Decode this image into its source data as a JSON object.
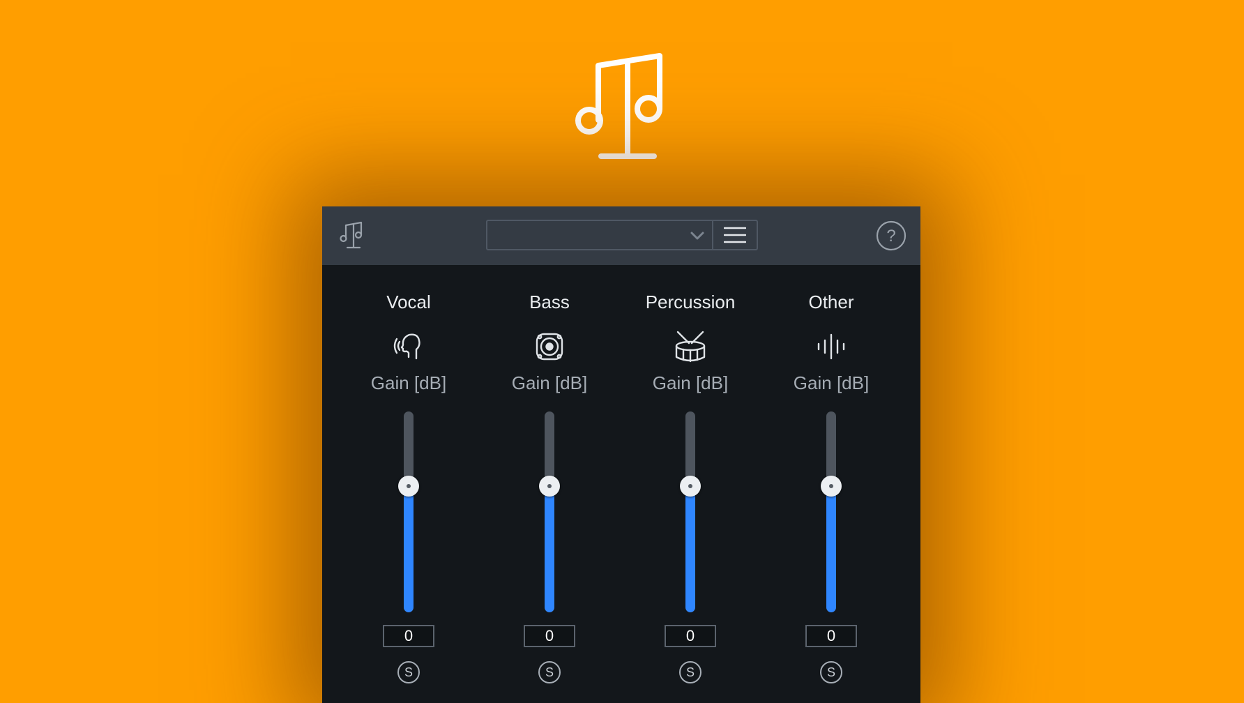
{
  "app": {
    "accent_color": "#2f86ff",
    "background_color": "#ff9e00",
    "logo_icon": "music-scale-icon"
  },
  "toolbar": {
    "preset_value": "",
    "preset_chevron_icon": "chevron-down-icon",
    "menu_icon": "hamburger-menu-icon",
    "help_icon": "help-circle-icon",
    "help_label": "?"
  },
  "channels": [
    {
      "name": "Vocal",
      "icon": "vocal-head-icon",
      "gain_label": "Gain [dB]",
      "gain_value": "0",
      "slider_level": 0.63,
      "solo_label": "S"
    },
    {
      "name": "Bass",
      "icon": "speaker-icon",
      "gain_label": "Gain [dB]",
      "gain_value": "0",
      "slider_level": 0.63,
      "solo_label": "S"
    },
    {
      "name": "Percussion",
      "icon": "drum-icon",
      "gain_label": "Gain [dB]",
      "gain_value": "0",
      "slider_level": 0.63,
      "solo_label": "S"
    },
    {
      "name": "Other",
      "icon": "waveform-icon",
      "gain_label": "Gain [dB]",
      "gain_value": "0",
      "slider_level": 0.63,
      "solo_label": "S"
    }
  ]
}
